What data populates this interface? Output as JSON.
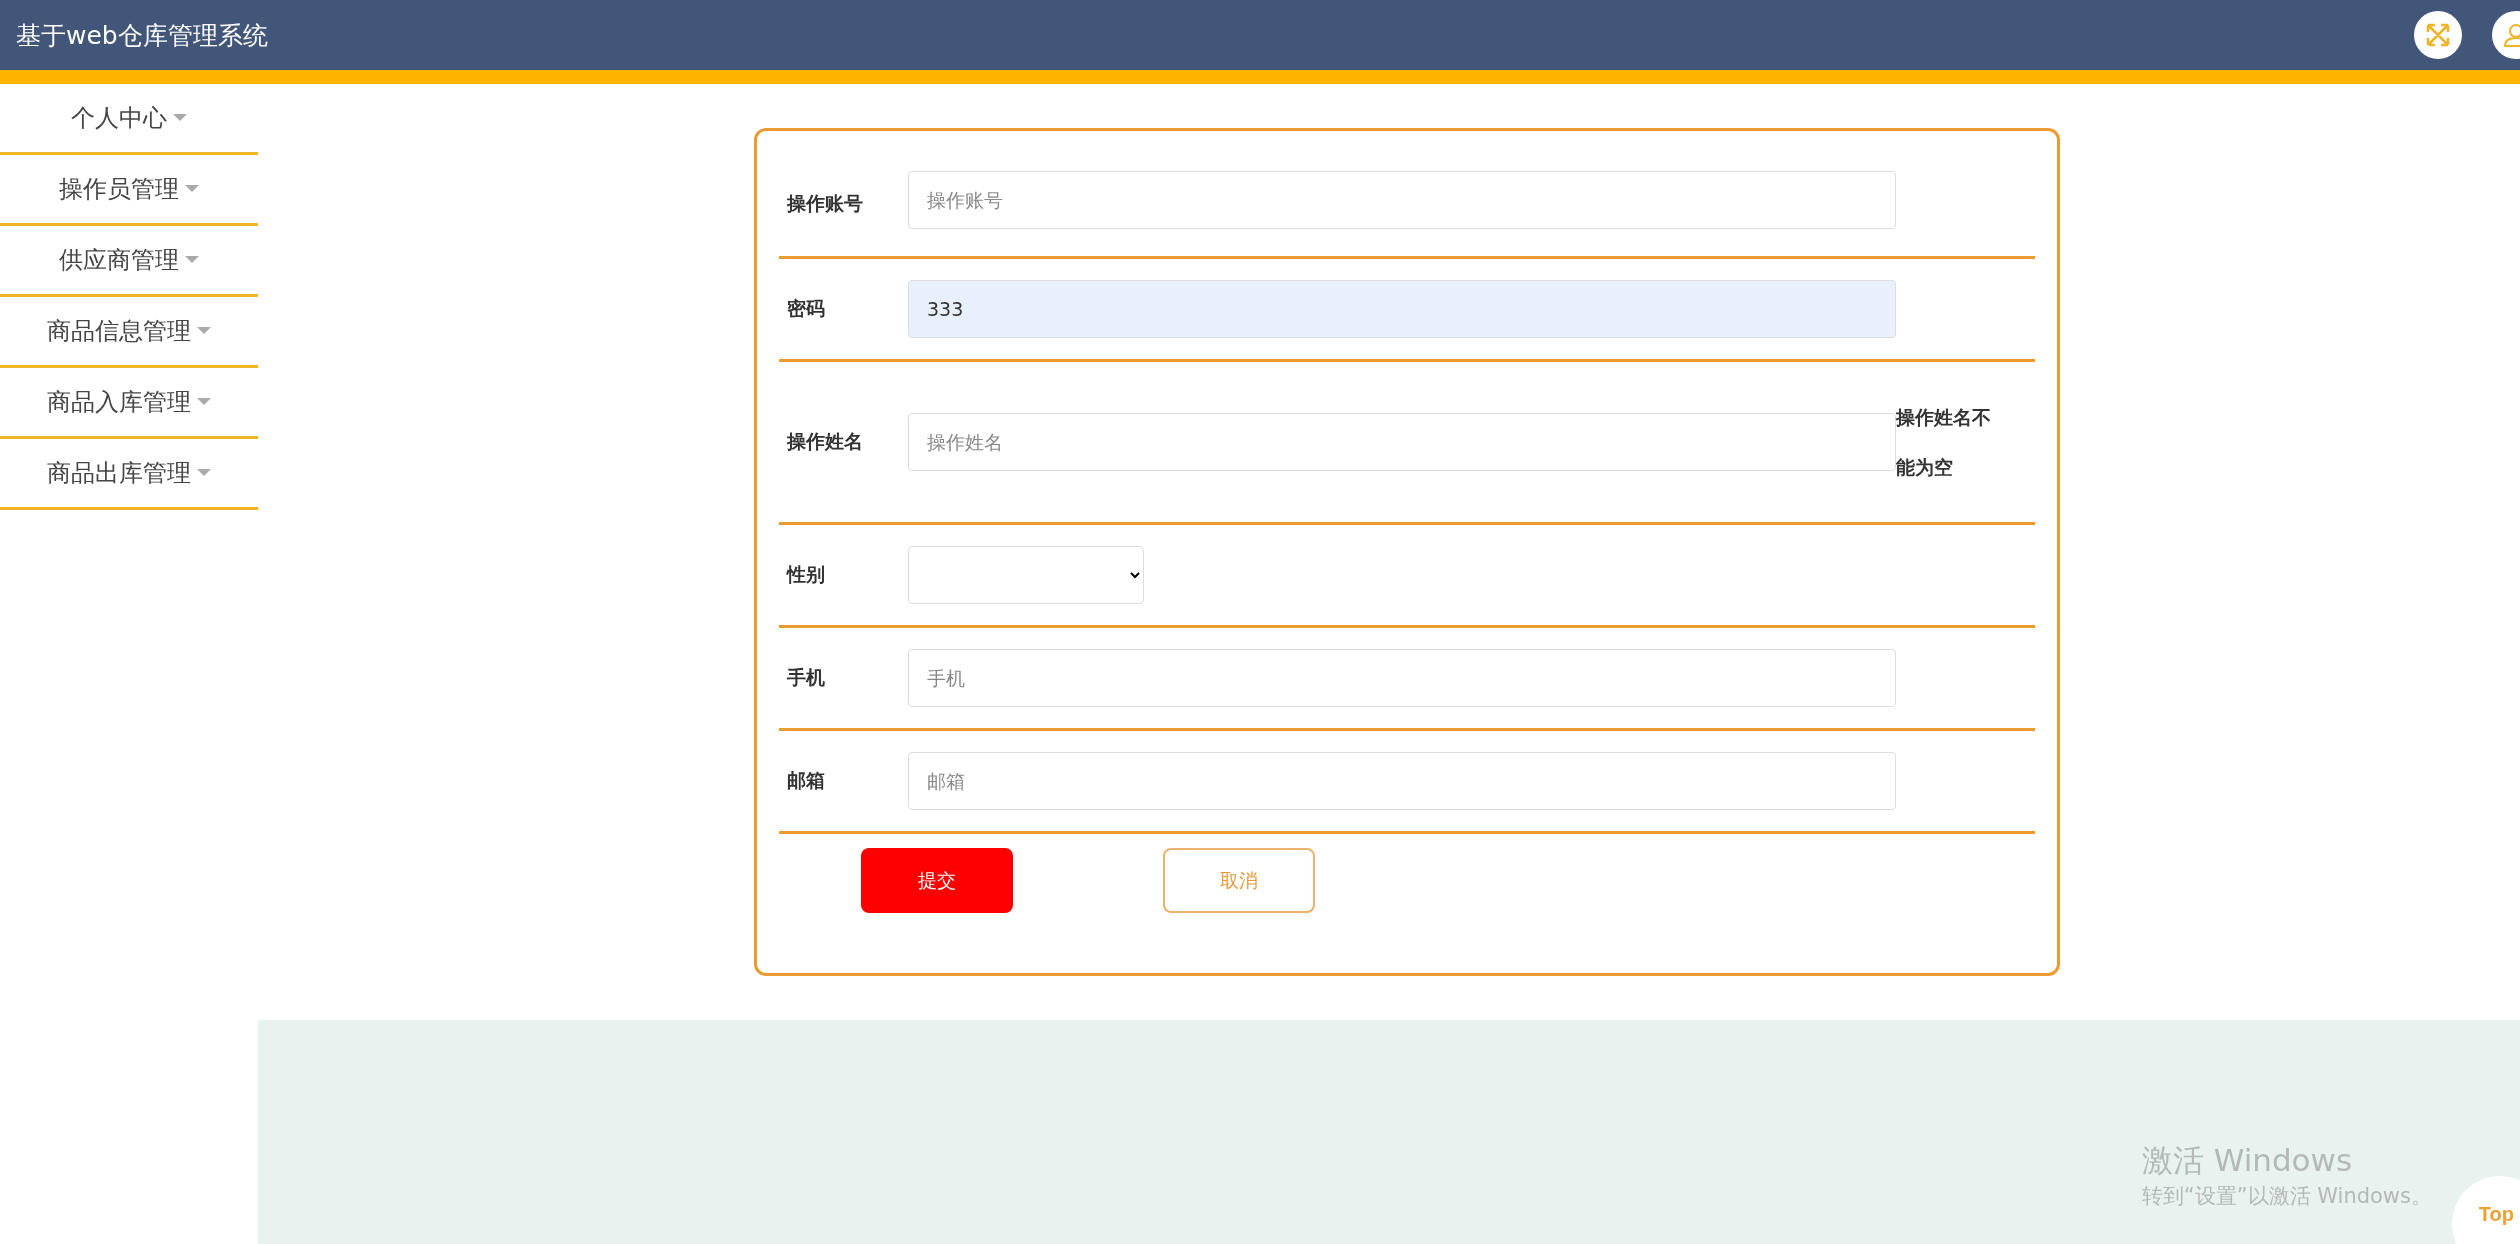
{
  "header": {
    "title": "基于web仓库管理系统"
  },
  "sidebar": {
    "items": [
      {
        "label": "个人中心"
      },
      {
        "label": "操作员管理"
      },
      {
        "label": "供应商管理"
      },
      {
        "label": "商品信息管理"
      },
      {
        "label": "商品入库管理"
      },
      {
        "label": "商品出库管理"
      }
    ]
  },
  "form": {
    "rows": [
      {
        "kind": "input",
        "label": "操作账号",
        "placeholder": "操作账号"
      },
      {
        "kind": "input",
        "label": "密码",
        "value": "333",
        "autofilled": true
      },
      {
        "kind": "input",
        "label": "操作姓名",
        "placeholder": "操作姓名",
        "error": "操作姓名不能为空"
      },
      {
        "kind": "select",
        "label": "性别"
      },
      {
        "kind": "input",
        "label": "手机",
        "placeholder": "手机"
      },
      {
        "kind": "input",
        "label": "邮箱",
        "placeholder": "邮箱"
      }
    ],
    "buttons": [
      {
        "kind": "primary",
        "label": "提交"
      },
      {
        "kind": "outline",
        "label": "取消"
      }
    ]
  },
  "activation_notice": {
    "title": "激活 Windows",
    "message": "转到“设置”以激活 Windows。"
  },
  "back_to_top": {
    "label": "Top"
  }
}
